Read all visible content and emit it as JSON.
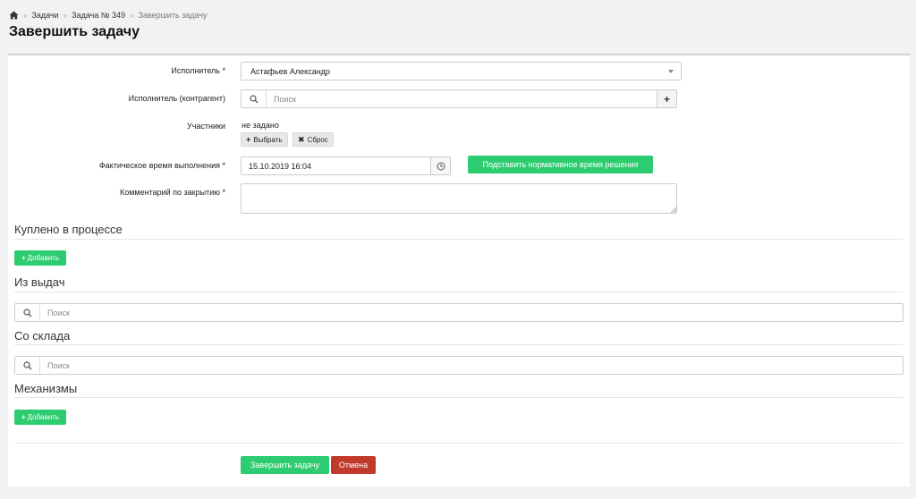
{
  "breadcrumb": {
    "items": [
      "Задачи",
      "Задача № 349"
    ],
    "current": "Завершить задачу",
    "separator": "»"
  },
  "page": {
    "title": "Завершить задачу"
  },
  "form": {
    "executor": {
      "label": "Исполнитель *",
      "value": "Астафьев Александр"
    },
    "contractor": {
      "label": "Исполнитель (контрагент)",
      "placeholder": "Поиск",
      "add_label": "+"
    },
    "participants": {
      "label": "Участники",
      "value": "не задано",
      "select_label": "Выбрать",
      "reset_label": "Сброс"
    },
    "actual_time": {
      "label": "Фактическое время выполнения *",
      "value": "15.10.2019 16:04",
      "normative_button": "Подставить нормативное время решения"
    },
    "closing_comment": {
      "label": "Комментарий по закрытию *",
      "value": ""
    }
  },
  "sections": {
    "bought": {
      "title": "Куплено в процессе",
      "add_label": "Добавить"
    },
    "issues": {
      "title": "Из выдач",
      "search_placeholder": "Поиск"
    },
    "warehouse": {
      "title": "Со склада",
      "search_placeholder": "Поиск"
    },
    "mechanisms": {
      "title": "Механизмы",
      "add_label": "Добавить"
    }
  },
  "actions": {
    "submit_label": "Завершить задачу",
    "cancel_label": "Отмена"
  },
  "icons": {
    "home": "home-icon",
    "search": "search-icon",
    "clock": "clock-icon",
    "plus": "plus-icon",
    "times": "times-icon",
    "caret": "caret-down-icon"
  },
  "colors": {
    "primary": "#2ecc71",
    "danger": "#c0392b",
    "background": "#f2f2f2"
  }
}
